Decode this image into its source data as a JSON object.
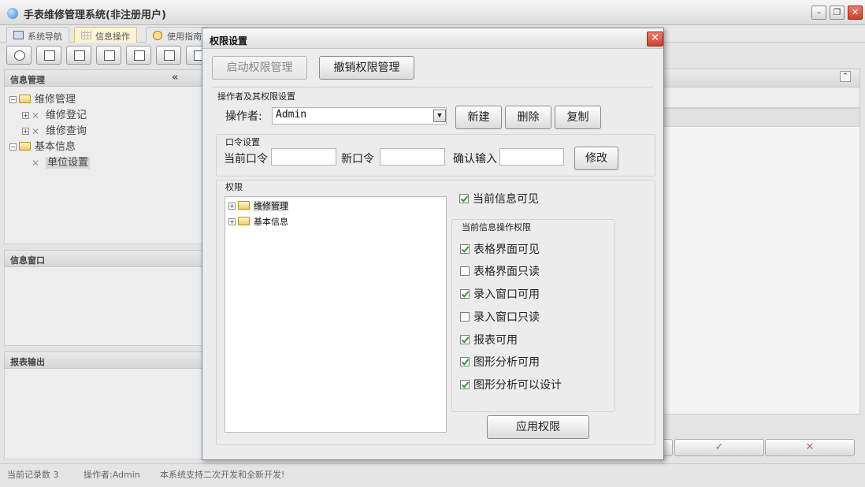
{
  "app": {
    "title": "手表维修管理系统(非注册用户)",
    "tabs": [
      {
        "label": "系统导航"
      },
      {
        "label": "信息操作"
      },
      {
        "label": "使用指南"
      }
    ]
  },
  "sidebar": {
    "info_mgmt_title": "信息管理",
    "tree": [
      {
        "label": "维修管理"
      },
      {
        "label": "维修登记"
      },
      {
        "label": "维修查询"
      },
      {
        "label": "基本信息"
      },
      {
        "label": "单位设置"
      }
    ],
    "info_window_title": "信息窗口",
    "report_title": "报表输出"
  },
  "status": {
    "records": "当前记录数 3",
    "operator": "操作者:Admin",
    "note": "本系统支持二次开发和全新开发!"
  },
  "dialog": {
    "title": "权限设置",
    "enable_btn": "启动权限管理",
    "revoke_btn": "撤销权限管理",
    "operator_group": "操作者及其权限设置",
    "operator_label": "操作者:",
    "operator_value": "Admin",
    "new_btn": "新建",
    "delete_btn": "删除",
    "copy_btn": "复制",
    "password_group": "口令设置",
    "current_pwd_label": "当前口令",
    "new_pwd_label": "新口令",
    "confirm_label": "确认输入",
    "modify_btn": "修改",
    "perm_group": "权限",
    "perm_tree": [
      {
        "label": "维修管理"
      },
      {
        "label": "基本信息"
      }
    ],
    "visible_label": "当前信息可见",
    "ops_group": "当前信息操作权限",
    "ops": [
      {
        "label": "表格界面可见",
        "checked": true
      },
      {
        "label": "表格界面只读",
        "checked": false
      },
      {
        "label": "录入窗口可用",
        "checked": true
      },
      {
        "label": "录入窗口只读",
        "checked": false
      },
      {
        "label": "报表可用",
        "checked": true
      },
      {
        "label": "图形分析可用",
        "checked": true
      },
      {
        "label": "图形分析可以设计",
        "checked": true
      }
    ],
    "apply_btn": "应用权限"
  }
}
